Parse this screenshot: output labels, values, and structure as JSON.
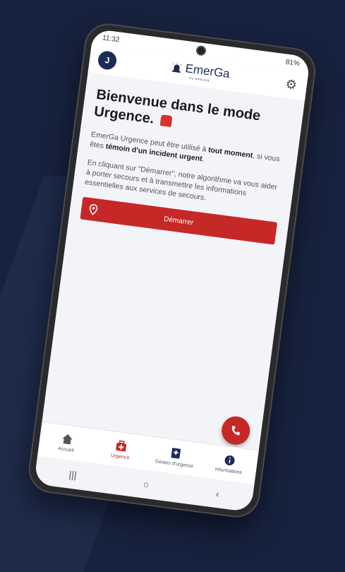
{
  "status": {
    "time": "11:32",
    "battery": "81%"
  },
  "header": {
    "avatar": "J",
    "logo": "EmerGa",
    "logo_sub": "by ambulia"
  },
  "main": {
    "title_line1": "Bienvenue dans le mode",
    "title_line2": "Urgence.",
    "p1_a": "EmerGa Urgence peut être utilisé à ",
    "p1_b": "tout moment",
    "p1_c": ", si vous êtes ",
    "p1_d": "témoin d'un incident urgent",
    "p1_e": ".",
    "p2": "En cliquant sur \"Démarrer\", notre algorithme va vous aider à porter secours et à transmettre les informations essentielles aux services de secours.",
    "start_label": "Démarrer"
  },
  "tabs": [
    {
      "label": "Accueil"
    },
    {
      "label": "Urgence"
    },
    {
      "label": "Gestes d'urgence"
    },
    {
      "label": "Informations"
    }
  ],
  "colors": {
    "accent": "#c62828",
    "navy": "#1c2a5a",
    "background": "#17223f"
  }
}
